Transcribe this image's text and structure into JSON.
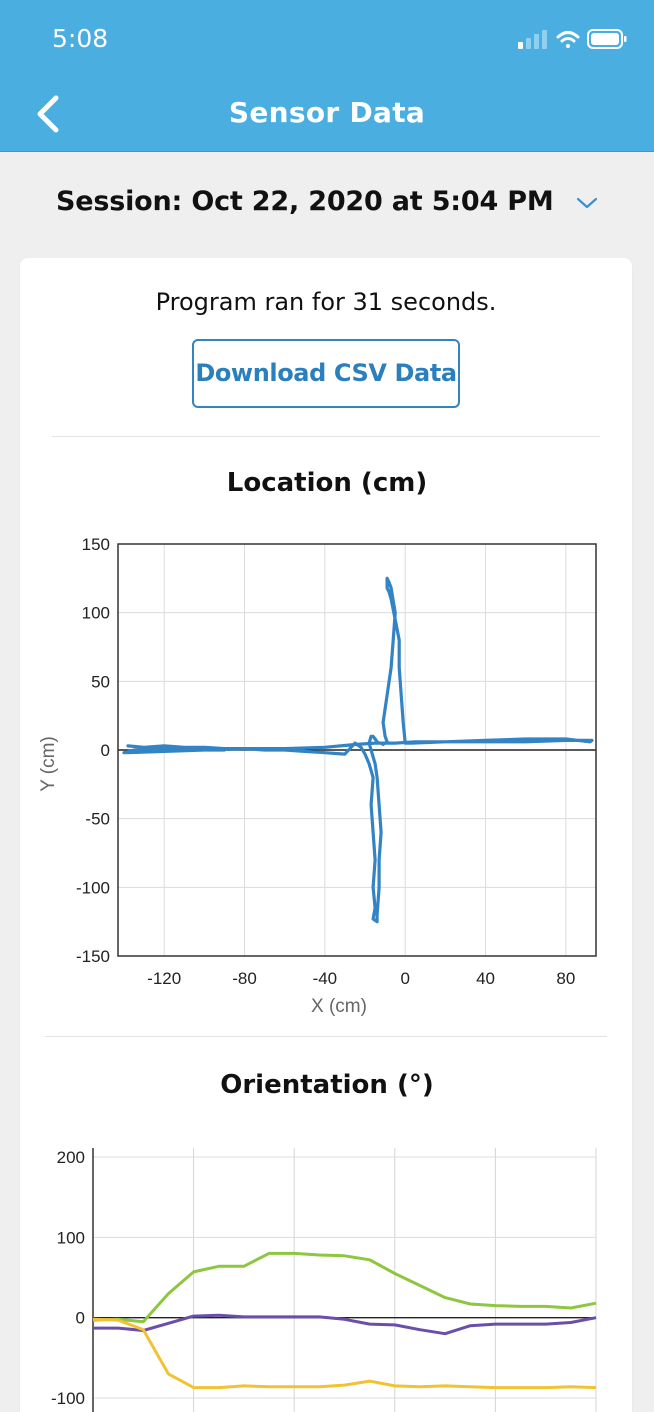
{
  "status_bar": {
    "time": "5:08"
  },
  "nav": {
    "title": "Sensor Data"
  },
  "session": {
    "label": "Session: Oct 22, 2020 at 5:04 PM"
  },
  "summary": {
    "ran_text": "Program ran for 31 seconds."
  },
  "download": {
    "label": "Download CSV Data"
  },
  "colors": {
    "header": "#4aaee0",
    "accent": "#2b7fbd",
    "trace": "#3384c4",
    "green": "#8dc63f",
    "purple": "#6a4eab",
    "yellow": "#f1c232"
  },
  "chart_data": [
    {
      "type": "line",
      "title": "Location (cm)",
      "xlabel": "X (cm)",
      "ylabel": "Y (cm)",
      "xlim": [
        -143,
        95
      ],
      "ylim": [
        -150,
        150
      ],
      "xticks": [
        -120,
        -80,
        -40,
        0,
        40,
        80
      ],
      "yticks": [
        150,
        100,
        50,
        0,
        -50,
        -100,
        -150
      ],
      "grid": true,
      "series": [
        {
          "x": [
            -138,
            -130,
            -120,
            -110,
            -100,
            -90,
            -80,
            -70,
            -60,
            -50,
            -40,
            -30,
            -25,
            -22,
            -20,
            -18,
            -16,
            -17,
            -16,
            -15,
            -16,
            -15,
            -16,
            -14,
            -14,
            -13,
            -13,
            -12,
            -13,
            -14,
            -15,
            -16,
            -17,
            -18,
            -17,
            -16,
            -15,
            -14,
            -13,
            -12,
            -11,
            -10,
            -9,
            -10,
            -11,
            -9,
            -7,
            -6,
            -5,
            -7,
            -8,
            -9,
            -9,
            -9,
            -8,
            -7,
            -5,
            -3,
            -3,
            -2,
            -1,
            0,
            3,
            20,
            40,
            60,
            80,
            92,
            93,
            80,
            60,
            40,
            20,
            5,
            -5,
            -15,
            -25,
            -40,
            -60,
            -80,
            -100,
            -120,
            -140,
            -135,
            -120,
            -100,
            -90
          ],
          "y": [
            3,
            2,
            3,
            2,
            2,
            1,
            1,
            0,
            0,
            -1,
            -2,
            -3,
            5,
            2,
            -3,
            -10,
            -20,
            -40,
            -60,
            -80,
            -100,
            -115,
            -123,
            -125,
            -120,
            -100,
            -80,
            -60,
            -40,
            -20,
            -10,
            -5,
            0,
            5,
            10,
            10,
            8,
            6,
            5,
            5,
            4,
            5,
            6,
            10,
            20,
            40,
            60,
            80,
            100,
            118,
            122,
            125,
            124,
            118,
            115,
            110,
            95,
            80,
            60,
            40,
            20,
            5,
            5,
            6,
            7,
            8,
            8,
            6,
            7,
            7,
            6,
            6,
            6,
            6,
            5,
            5,
            4,
            2,
            1,
            1,
            0,
            -1,
            -2,
            0,
            1,
            0,
            0
          ]
        }
      ]
    },
    {
      "type": "line",
      "title": "Orientation (°)",
      "ylim": [
        -100,
        200
      ],
      "yticks": [
        200,
        100,
        0,
        -100
      ],
      "grid": true,
      "series": [
        {
          "color": "green",
          "x": [
            0,
            0.5,
            1,
            1.5,
            2,
            2.5,
            3,
            3.5,
            4,
            4.5,
            5,
            5.5,
            6,
            6.5,
            7,
            7.5,
            8,
            8.5,
            9,
            9.5,
            10
          ],
          "y": [
            -3,
            -2,
            -5,
            30,
            57,
            64,
            64,
            80,
            80,
            78,
            77,
            72,
            55,
            40,
            25,
            17,
            15,
            14,
            14,
            12,
            18
          ]
        },
        {
          "color": "purple",
          "x": [
            0,
            0.5,
            1,
            1.5,
            2,
            2.5,
            3,
            3.5,
            4,
            4.5,
            5,
            5.5,
            6,
            6.5,
            7,
            7.5,
            8,
            8.5,
            9,
            9.5,
            10
          ],
          "y": [
            -13,
            -13,
            -16,
            -7,
            2,
            3,
            1,
            1,
            1,
            1,
            -2,
            -8,
            -9,
            -15,
            -20,
            -10,
            -8,
            -8,
            -8,
            -6,
            0
          ]
        },
        {
          "color": "yellow",
          "x": [
            0,
            0.5,
            1,
            1.5,
            2,
            2.5,
            3,
            3.5,
            4,
            4.5,
            5,
            5.5,
            6,
            6.5,
            7,
            7.5,
            8,
            8.5,
            9,
            9.5,
            10
          ],
          "y": [
            -2,
            -3,
            -15,
            -70,
            -87,
            -87,
            -85,
            -86,
            -86,
            -86,
            -84,
            -79,
            -85,
            -86,
            -85,
            -86,
            -87,
            -87,
            -87,
            -86,
            -87
          ]
        }
      ]
    }
  ]
}
